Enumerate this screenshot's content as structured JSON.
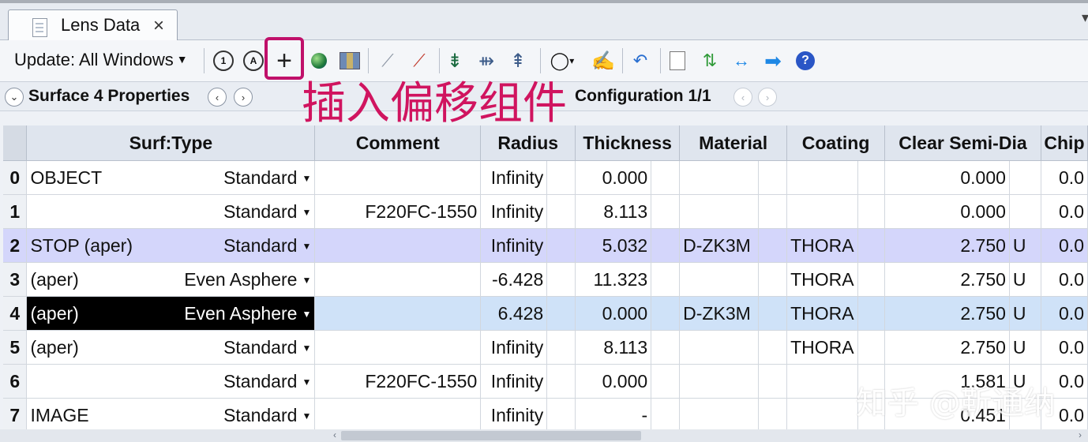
{
  "tab": {
    "label": "Lens Data",
    "close": "×"
  },
  "toolbar": {
    "update_label": "Update: All Windows"
  },
  "properties": {
    "title": "Surface 4 Properties",
    "config": "Configuration 1/1"
  },
  "annotation": "插入偏移组件",
  "watermark": "知乎 @靳通纳",
  "colors": {
    "annotation": "#d0145f",
    "stop_row": "#d4d6fb",
    "selected_row": "#cfe2f8"
  },
  "table": {
    "headers": [
      "Surf:Type",
      "Comment",
      "Radius",
      "Thickness",
      "Material",
      "Coating",
      "Clear Semi-Dia",
      "Chip"
    ],
    "rows": [
      {
        "idx": "0",
        "name": "OBJECT",
        "type": "Standard",
        "comment": "",
        "radius": "Infinity",
        "thickness": "0.000",
        "material": "",
        "coating": "",
        "semidia": "0.000",
        "semidia_flag": "",
        "chip": "0.0"
      },
      {
        "idx": "1",
        "name": "",
        "type": "Standard",
        "comment": "F220FC-1550",
        "radius": "Infinity",
        "thickness": "8.113",
        "material": "",
        "coating": "",
        "semidia": "0.000",
        "semidia_flag": "",
        "chip": "0.0"
      },
      {
        "idx": "2",
        "name": "STOP (aper)",
        "type": "Standard",
        "comment": "",
        "radius": "Infinity",
        "thickness": "5.032",
        "material": "D-ZK3M",
        "coating": "THORA",
        "semidia": "2.750",
        "semidia_flag": "U",
        "chip": "0.0"
      },
      {
        "idx": "3",
        "name": "(aper)",
        "type": "Even Asphere",
        "comment": "",
        "radius": "-6.428",
        "thickness": "11.323",
        "material": "",
        "coating": "THORA",
        "semidia": "2.750",
        "semidia_flag": "U",
        "chip": "0.0"
      },
      {
        "idx": "4",
        "name": "(aper)",
        "type": "Even Asphere",
        "comment": "",
        "radius": "6.428",
        "thickness": "0.000",
        "material": "D-ZK3M",
        "coating": "THORA",
        "semidia": "2.750",
        "semidia_flag": "U",
        "chip": "0.0"
      },
      {
        "idx": "5",
        "name": "(aper)",
        "type": "Standard",
        "comment": "",
        "radius": "Infinity",
        "thickness": "8.113",
        "material": "",
        "coating": "THORA",
        "semidia": "2.750",
        "semidia_flag": "U",
        "chip": "0.0"
      },
      {
        "idx": "6",
        "name": "",
        "type": "Standard",
        "comment": "F220FC-1550",
        "radius": "Infinity",
        "thickness": "0.000",
        "material": "",
        "coating": "",
        "semidia": "1.581",
        "semidia_flag": "U",
        "chip": "0.0"
      },
      {
        "idx": "7",
        "name": "IMAGE",
        "type": "Standard",
        "comment": "",
        "radius": "Infinity",
        "thickness": "-",
        "material": "",
        "coating": "",
        "semidia": "0.451",
        "semidia_flag": "",
        "chip": "0.0"
      }
    ]
  }
}
